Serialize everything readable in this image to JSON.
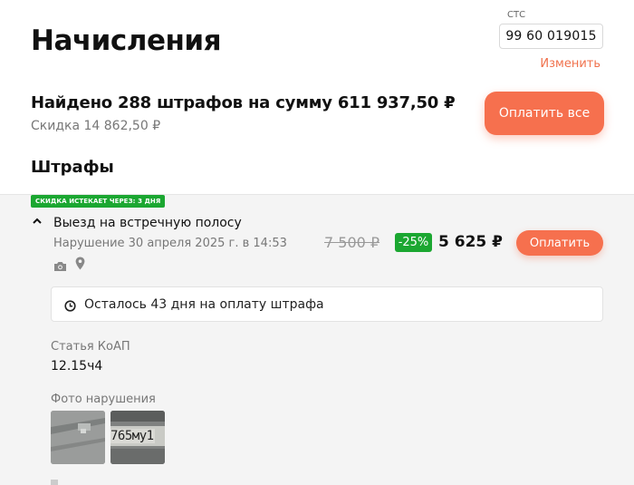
{
  "page": {
    "title": "Начисления"
  },
  "sts": {
    "label": "СТС",
    "value": "99 60 019015",
    "change_label": "Изменить"
  },
  "summary": {
    "title": "Найдено 288 штрафов на сумму 611 937,50 ₽",
    "discount": "Скидка 14 862,50 ₽",
    "pay_all_label": "Оплатить все"
  },
  "section": {
    "title": "Штрафы"
  },
  "fine": {
    "discount_tag": "СКИДКА ИСТЕКАЕТ ЧЕРЕЗ: 3 ДНЯ",
    "title": "Выезд на встречную полосу",
    "date": "Нарушение 30 апреля 2025 г. в 14:53",
    "old_price": "7 500 ₽",
    "discount_percent": "-25%",
    "new_price": "5 625 ₽",
    "pay_label": "Оплатить",
    "deadline": "Осталось 43 дня на оплату штрафа",
    "article_label": "Статья КоАП",
    "article_value": "12.15ч4",
    "photos_label": "Фото нарушения",
    "plate_fragment": "765му1"
  },
  "colors": {
    "accent": "#f6704e",
    "discount_green": "#1ba731"
  },
  "icons": [
    "chevron-up-icon",
    "camera-icon",
    "map-pin-icon",
    "clock-icon"
  ]
}
